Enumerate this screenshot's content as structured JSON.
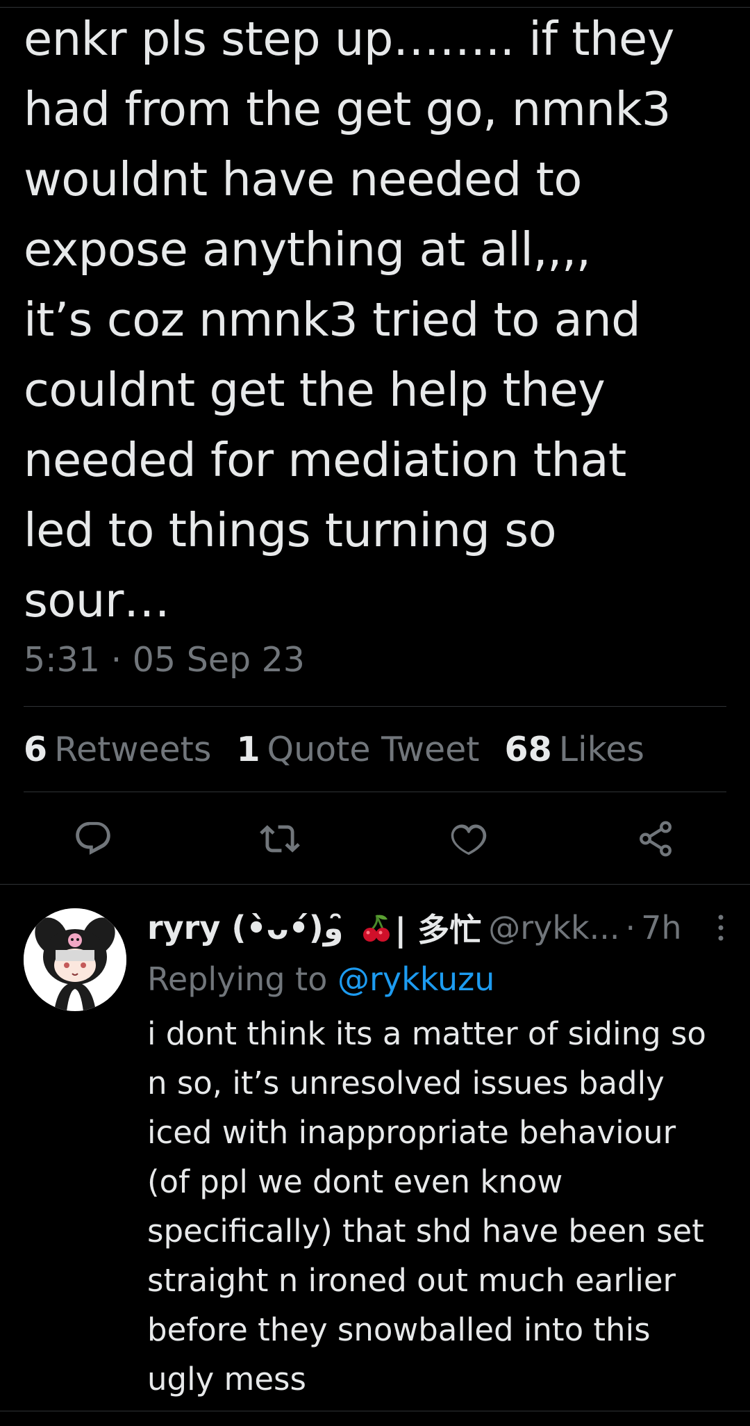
{
  "main_tweet": {
    "text": "enkr pls step up…….. if they\nhad from the get go, nmnk3\nwouldnt have needed to\nexpose anything at all,,,,\nit’s coz nmnk3 tried to and\ncouldnt get the help they\nneeded for mediation that\nled to things turning so\nsour…",
    "timestamp": "5:31 · 05 Sep 23",
    "stats": {
      "retweets_count": "6",
      "retweets_label": "Retweets",
      "quotes_count": "1",
      "quotes_label": "Quote Tweet",
      "likes_count": "68",
      "likes_label": "Likes"
    },
    "actions": [
      "reply-icon",
      "retweet-icon",
      "like-icon",
      "share-icon"
    ]
  },
  "reply": {
    "display_name": "ryry (•̀ᴗ•́)و ̑̑",
    "name_emoji": "cherry-icon",
    "name_suffix": "| 多忙",
    "handle": "@rykk...",
    "separator": "·",
    "time": "7h",
    "replying_to_label": "Replying to",
    "replying_to_handle": "@rykkuzu",
    "text": "i dont think its a matter of siding so\nn so, it’s unresolved issues badly\niced with inappropriate behaviour\n(of ppl we dont even know\nspecifically) that shd have been set\nstraight n ironed out much earlier\nbefore they snowballed into this\nugly mess"
  },
  "colors": {
    "background": "#000000",
    "text_primary": "#e7e9ea",
    "text_secondary": "#71767b",
    "accent": "#1d9bf0",
    "divider": "#2f3336"
  }
}
